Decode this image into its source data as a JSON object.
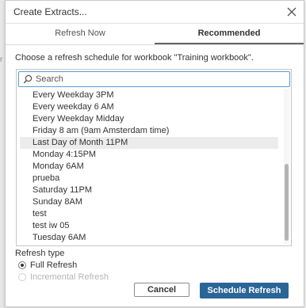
{
  "background": {
    "edge_char": "r"
  },
  "dialog": {
    "title": "Create Extracts...",
    "close_icon": "close-icon"
  },
  "tabs": [
    {
      "label": "Refresh Now",
      "active": false
    },
    {
      "label": "Recommended",
      "active": true
    }
  ],
  "prompt": "Choose a refresh schedule for workbook \"Training workbook\".",
  "search": {
    "placeholder": "Search",
    "value": "",
    "icon": "search-icon"
  },
  "schedules": [
    "Every Weekday 3PM",
    "Every weekday 6 AM",
    "Every Weekday Midday",
    "Friday 8 am (9am Amsterdam time)",
    "Last Day of Month 11PM",
    "Monday 4:15PM",
    "Monday 6AM",
    "prueba",
    "Saturday 11PM",
    "Sunday 8AM",
    "test",
    "test iw 05",
    "Tuesday 6AM"
  ],
  "selected_schedule": "Last Day of Month 11PM",
  "scroll": {
    "position": 0.98
  },
  "refresh_type": {
    "label": "Refresh type",
    "options": [
      {
        "label": "Full Refresh",
        "checked": true,
        "disabled": false
      },
      {
        "label": "Incremental Refresh",
        "checked": false,
        "disabled": true
      }
    ]
  },
  "buttons": {
    "cancel": "Cancel",
    "schedule": "Schedule Refresh"
  },
  "colors": {
    "primary": "#2a6598",
    "search_border": "#5a9bd4",
    "selected_row": "#ececec"
  }
}
